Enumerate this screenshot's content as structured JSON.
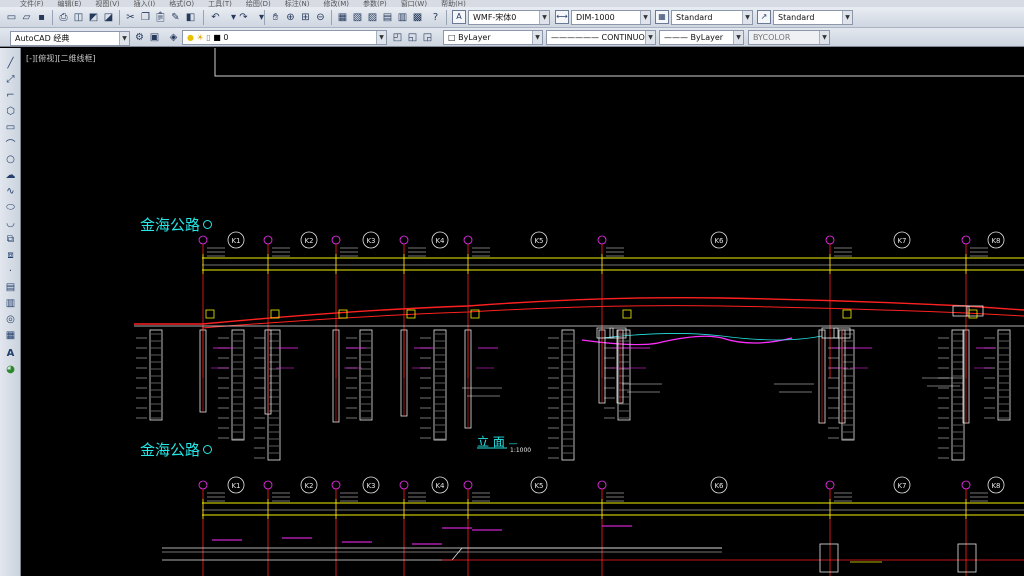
{
  "menubar": {
    "items": [
      "文件(F)",
      "编辑(E)",
      "视图(V)",
      "插入(I)",
      "格式(O)",
      "工具(T)",
      "绘图(D)",
      "标注(N)",
      "修改(M)",
      "参数(P)",
      "窗口(W)",
      "帮助(H)"
    ]
  },
  "toolbar": {
    "text_style": "WMF-宋体0",
    "dim_style": "DIM-1000",
    "table_style": "Standard",
    "multileader_style": "Standard"
  },
  "workspace": {
    "name": "AutoCAD 经典",
    "layer": "0",
    "color": "ByLayer",
    "linetype": "CONTINUOUS",
    "lineweight": "ByLayer",
    "plotstyle": "BYCOLOR"
  },
  "viewport": {
    "label": "[-][俯视][二维线框]"
  },
  "drawing": {
    "road_label": "金海公路",
    "elevation_label": "立 面",
    "elevation_scale": "1:1000",
    "axis_labels": [
      "K1",
      "K2",
      "K3",
      "K4",
      "K5",
      "K6",
      "K7",
      "K8"
    ],
    "colors": {
      "background": "#000000",
      "red": "#ff2020",
      "magenta": "#ff2dff",
      "yellow": "#f0f000",
      "white": "#e8e8e8",
      "cyan": "#26e6e6"
    }
  }
}
